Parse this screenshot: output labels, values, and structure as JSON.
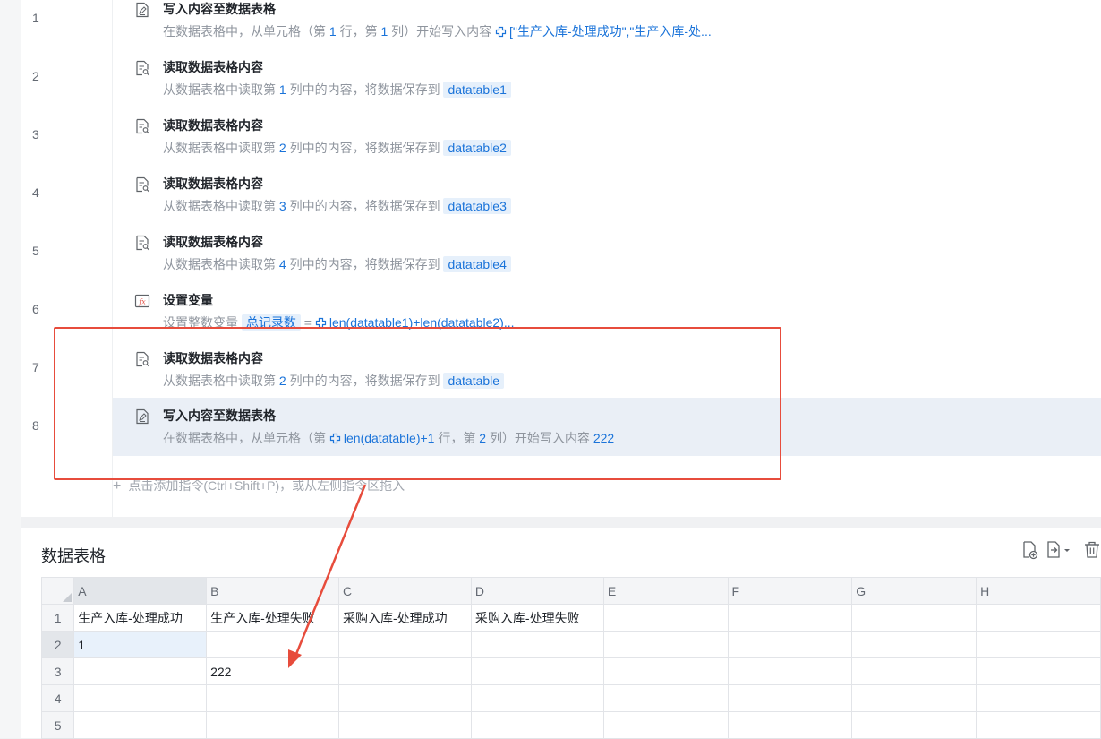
{
  "flow": {
    "line_numbers": [
      "1",
      "2",
      "3",
      "4",
      "5",
      "6",
      "7",
      "8"
    ],
    "steps": [
      {
        "title": "写入内容至数据表格",
        "icon": "write-table-icon",
        "d1": "在数据表格中，从单元格（第",
        "n1": "1",
        "d2": "行，第",
        "n2": "1",
        "d3": "列）开始写入内容",
        "expr": "[\"生产入库-处理成功\",\"生产入库-处..."
      },
      {
        "title": "读取数据表格内容",
        "icon": "read-table-icon",
        "d1": "从数据表格中读取第",
        "col": "1",
        "d2": "列中的内容，将数据保存到",
        "var": "datatable1"
      },
      {
        "title": "读取数据表格内容",
        "icon": "read-table-icon",
        "d1": "从数据表格中读取第",
        "col": "2",
        "d2": "列中的内容，将数据保存到",
        "var": "datatable2"
      },
      {
        "title": "读取数据表格内容",
        "icon": "read-table-icon",
        "d1": "从数据表格中读取第",
        "col": "3",
        "d2": "列中的内容，将数据保存到",
        "var": "datatable3"
      },
      {
        "title": "读取数据表格内容",
        "icon": "read-table-icon",
        "d1": "从数据表格中读取第",
        "col": "4",
        "d2": "列中的内容，将数据保存到",
        "var": "datatable4"
      },
      {
        "title": "设置变量",
        "icon": "set-variable-icon",
        "d1": "设置整数变量",
        "var": "总记录数",
        "eq": "=",
        "expr": "len(datatable1)+len(datatable2)..."
      },
      {
        "title": "读取数据表格内容",
        "icon": "read-table-icon",
        "d1": "从数据表格中读取第",
        "col": "2",
        "d2": "列中的内容，将数据保存到",
        "var": "datatable"
      },
      {
        "title": "写入内容至数据表格",
        "icon": "write-table-icon",
        "d1": "在数据表格中，从单元格（第",
        "expr": "len(datatable)+1",
        "d2": "行，第",
        "n2": "2",
        "d3": "列）开始写入内容",
        "val": "222"
      }
    ],
    "add_hint": "点击添加指令(Ctrl+Shift+P)，或从左侧指令区拖入"
  },
  "datatable": {
    "title": "数据表格",
    "tools": [
      "add-file-icon",
      "export-icon",
      "delete-icon"
    ],
    "columns": [
      "A",
      "B",
      "C",
      "D",
      "E",
      "F",
      "G",
      "H"
    ],
    "rows": [
      {
        "n": "1",
        "cells": [
          "生产入库-处理成功",
          "生产入库-处理失败",
          "采购入库-处理成功",
          "采购入库-处理失败",
          "",
          "",
          "",
          ""
        ]
      },
      {
        "n": "2",
        "cells": [
          "1",
          "",
          "",
          "",
          "",
          "",
          "",
          ""
        ]
      },
      {
        "n": "3",
        "cells": [
          "",
          "222",
          "",
          "",
          "",
          "",
          "",
          ""
        ]
      },
      {
        "n": "4",
        "cells": [
          "",
          "",
          "",
          "",
          "",
          "",
          "",
          ""
        ]
      },
      {
        "n": "5",
        "cells": [
          "",
          "",
          "",
          "",
          "",
          "",
          "",
          ""
        ]
      }
    ]
  },
  "colors": {
    "accent": "#1a73d9",
    "annotation": "#e74c3c",
    "selected_row": "#eaeff6"
  }
}
